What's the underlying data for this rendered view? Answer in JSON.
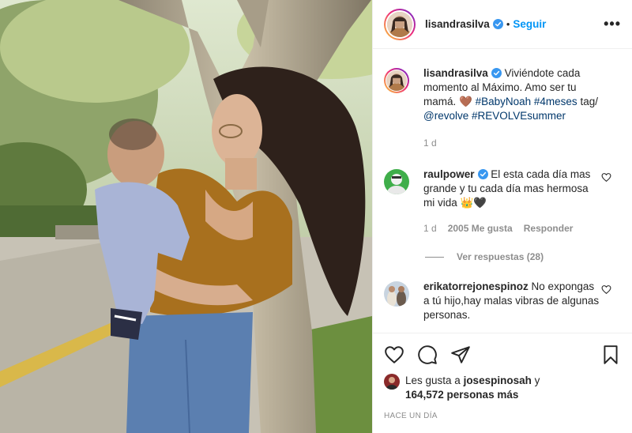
{
  "post": {
    "author": "lisandrasilva",
    "follow_label": "Seguir",
    "separator": "•",
    "more_label": "•••"
  },
  "caption": {
    "username": "lisandrasilva",
    "text_plain": " Viviéndote cada momento al Máximo. Amo ser tu mamá. 🤎 ",
    "tag1": "#BabyNoah",
    "tag2": "#4meses",
    "text_mid": " tag/ ",
    "tag3": "@revolve",
    "tag4": "#REVOLVEsummer",
    "time": "1 d"
  },
  "comments": [
    {
      "username": "raulpower",
      "text": " El esta cada día mas grande y tu cada día mas hermosa mi vida 👑🖤",
      "time": "1 d",
      "likes": "2005 Me gusta",
      "reply_label": "Responder",
      "view_replies": "Ver respuestas (28)"
    },
    {
      "username": "erikatorrejonespinoz",
      "text": " No expongas a tú hijo,hay malas vibras de algunas personas."
    }
  ],
  "likes_summary": {
    "prefix": "Les gusta a ",
    "user": "josespinosah",
    "mid": " y ",
    "count": "164,572 personas más"
  },
  "timestamp": "HACE UN DÍA",
  "colors": {
    "follow": "#0095f6",
    "verified": "#3897f0",
    "tag": "#00376b",
    "muted": "#8e8e8e"
  },
  "icons": [
    "heart-icon",
    "comment-icon",
    "share-icon",
    "bookmark-icon",
    "verified-badge-icon",
    "more-options-icon"
  ]
}
